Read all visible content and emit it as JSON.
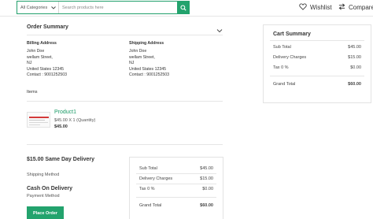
{
  "header": {
    "category_label": "All Categories",
    "search_placeholder": "Search products here",
    "wishlist_label": "Wishlist",
    "compare_label": "Compare"
  },
  "order": {
    "title": "Order Summary",
    "billing": {
      "heading": "Billing Address",
      "lines": [
        "John Doe",
        "wellam Street,",
        "NJ",
        "United States 12345",
        "Contact : 9001252503"
      ]
    },
    "shipping": {
      "heading": "Shipping Address",
      "lines": [
        "John Doe",
        "wellam Street,",
        "NJ",
        "United States 12345",
        "Contact : 9001252503"
      ]
    },
    "items_label": "Items",
    "items": [
      {
        "name": "Product1",
        "quantity_text": "$45.00 X 1 (Quantity)",
        "price": "$45.00"
      }
    ],
    "shipping_method_title": "$15.00 Same Day Delivery",
    "shipping_method_label": "Shipping Method",
    "payment_title": "Cash On Delivery",
    "payment_label": "Payment Method",
    "place_order_label": "Place Order",
    "summary": {
      "subtotal_label": "Sub Total",
      "subtotal": "$45.00",
      "delivery_label": "Delivery Charges",
      "delivery": "$15.00",
      "tax_label": "Tax 0 %",
      "tax": "$0.00",
      "grand_label": "Grand Total",
      "grand": "$60.00"
    }
  },
  "cart": {
    "title": "Cart Summary",
    "subtotal_label": "Sub Total",
    "subtotal": "$45.00",
    "delivery_label": "Delivery Charges",
    "delivery": "$15.00",
    "tax_label": "Tax 0 %",
    "tax": "$0.00",
    "grand_label": "Grand Total",
    "grand": "$60.00"
  },
  "colors": {
    "accent": "#23a36d",
    "link": "#1a9a66",
    "border": "#e3e3e3"
  },
  "icons": [
    "chevron-down-icon",
    "search-icon",
    "heart-icon",
    "compare-icon",
    "chevron-down-icon"
  ]
}
